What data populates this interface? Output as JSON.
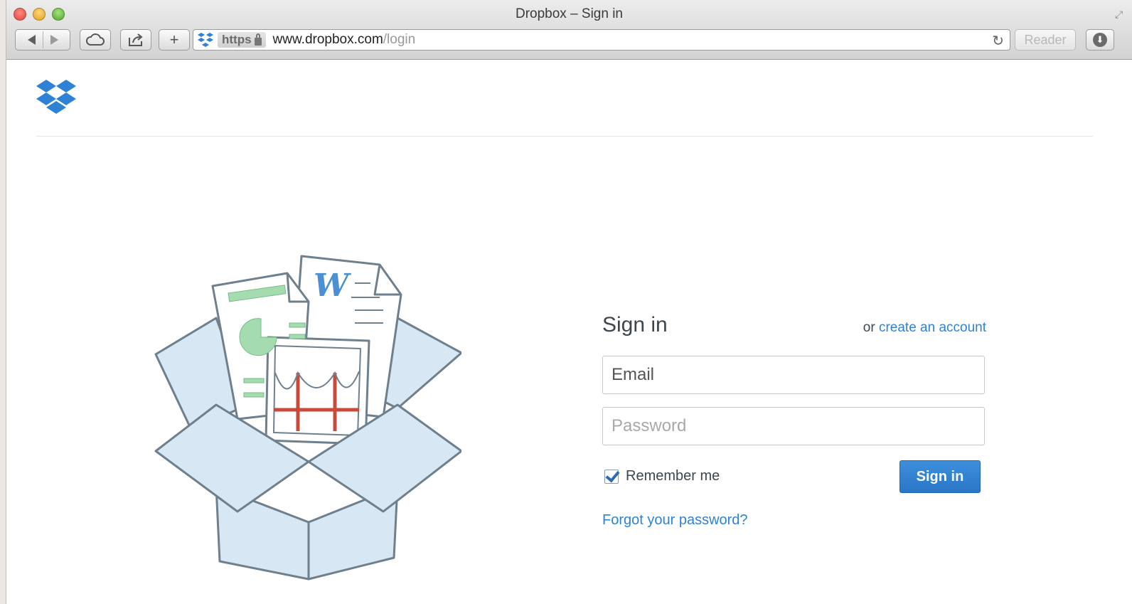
{
  "window": {
    "title": "Dropbox – Sign in"
  },
  "toolbar": {
    "url_scheme": "https",
    "url_domain": "www.dropbox.com",
    "url_path": "/login",
    "reader_label": "Reader"
  },
  "signin": {
    "title": "Sign in",
    "or_text": "or ",
    "create_account_label": "create an account",
    "email_placeholder": "Email",
    "password_placeholder": "Password",
    "remember_label": "Remember me",
    "remember_checked": true,
    "submit_label": "Sign in",
    "forgot_label": "Forgot your password?"
  },
  "colors": {
    "brand_blue": "#2e82d5",
    "button_blue": "#2a76c6",
    "text_dark": "#3d464d"
  }
}
